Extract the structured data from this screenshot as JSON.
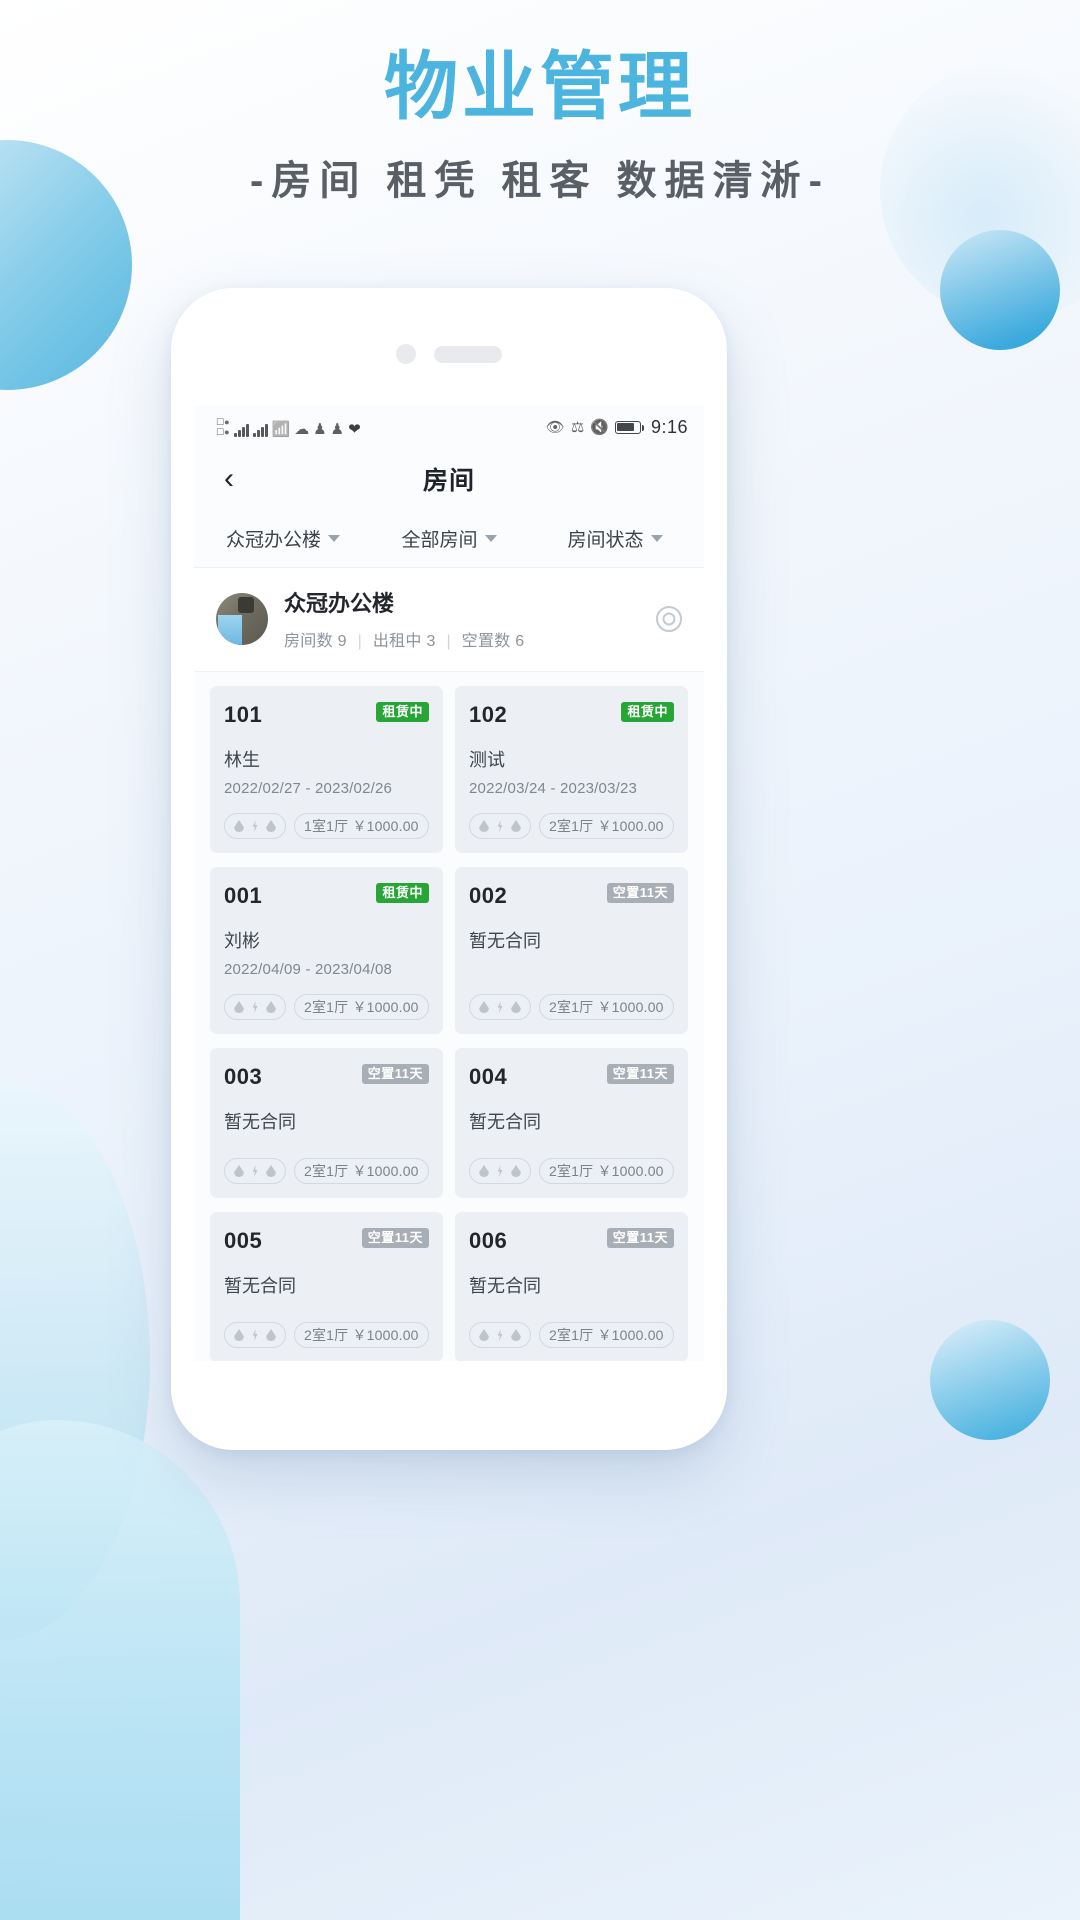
{
  "promo": {
    "title": "物业管理",
    "subtitle": "-房间 租凭 租客 数据清淅-",
    "title_color": "#4bb4df"
  },
  "statusbar": {
    "time": "9:16",
    "left_icons": [
      "sim-card-icon",
      "signal-bars-icon",
      "signal-bars-icon",
      "wifi-icon",
      "cloud-icon",
      "app-icon",
      "app-icon",
      "heart-icon"
    ],
    "right_icons": [
      "eye-icon",
      "bluetooth-icon",
      "mute-icon",
      "battery-icon"
    ]
  },
  "navbar": {
    "back_label": "‹",
    "title": "房间"
  },
  "filters": [
    {
      "label": "众冠办公楼"
    },
    {
      "label": "全部房间"
    },
    {
      "label": "房间状态"
    }
  ],
  "building": {
    "name": "众冠办公楼",
    "stat_rooms": "房间数 9",
    "stat_rented": "出租中 3",
    "stat_vacant": "空置数 6",
    "separator": "|",
    "settings_icon": "gear-icon"
  },
  "rooms": [
    {
      "number": "101",
      "status": "租赁中",
      "status_type": "rented",
      "tenant": "林生",
      "dates": "2022/02/27 - 2023/02/26",
      "meters": "水电气",
      "spec": "1室1厅 ￥1000.00"
    },
    {
      "number": "102",
      "status": "租赁中",
      "status_type": "rented",
      "tenant": "测试",
      "dates": "2022/03/24 - 2023/03/23",
      "meters": "水电气",
      "spec": "2室1厅 ￥1000.00"
    },
    {
      "number": "001",
      "status": "租赁中",
      "status_type": "rented",
      "tenant": "刘彬",
      "dates": "2022/04/09 - 2023/04/08",
      "meters": "水电气",
      "spec": "2室1厅 ￥1000.00"
    },
    {
      "number": "002",
      "status": "空置11天",
      "status_type": "vacant",
      "tenant": "暂无合同",
      "dates": "",
      "meters": "水电气",
      "spec": "2室1厅 ￥1000.00"
    },
    {
      "number": "003",
      "status": "空置11天",
      "status_type": "vacant",
      "tenant": "暂无合同",
      "dates": "",
      "meters": "水电气",
      "spec": "2室1厅 ￥1000.00"
    },
    {
      "number": "004",
      "status": "空置11天",
      "status_type": "vacant",
      "tenant": "暂无合同",
      "dates": "",
      "meters": "水电气",
      "spec": "2室1厅 ￥1000.00"
    },
    {
      "number": "005",
      "status": "空置11天",
      "status_type": "vacant",
      "tenant": "暂无合同",
      "dates": "",
      "meters": "水电气",
      "spec": "2室1厅 ￥1000.00"
    },
    {
      "number": "006",
      "status": "空置11天",
      "status_type": "vacant",
      "tenant": "暂无合同",
      "dates": "",
      "meters": "水电气",
      "spec": "2室1厅 ￥1000.00"
    }
  ],
  "colors": {
    "brand": "#4bb4df",
    "rented_badge": "#27a536",
    "vacant_badge": "#a8aeb5",
    "card_bg": "#eceff4"
  }
}
